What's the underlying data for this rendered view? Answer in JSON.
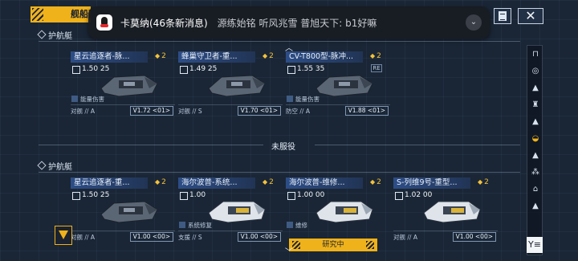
{
  "header": {
    "tab_label": "舰船蓝"
  },
  "notification": {
    "title": "卡莫纳(46条新消息)",
    "message": "源练始铭 听风兆雪  普旭天下: b1好嘛",
    "expand_icon": "chevron-down-icon"
  },
  "toolbar": {
    "doc_icon": "document-icon",
    "close_icon": "close-icon",
    "close_label": "✕"
  },
  "sections": {
    "escort_top": "护航艇",
    "unassigned": "未服役",
    "escort_bottom": "护航艇"
  },
  "active_ships": [
    {
      "name": "星云追逐者-脉...",
      "badge": "2",
      "level": "1.50",
      "level_suffix": "25",
      "tag": "能量伤害",
      "role": "对舰",
      "grade": "A",
      "version": "V1.72 <01>"
    },
    {
      "name": "蜂巢守卫者-重...",
      "badge": "2",
      "level": "1.49",
      "level_suffix": "25",
      "tag": "",
      "role": "对舰",
      "grade": "S",
      "version": "V1.70 <01>"
    },
    {
      "name": "CV-T800型-脉冲...",
      "badge": "2",
      "level": "1.55",
      "level_suffix": "35",
      "extra": "RE",
      "tag": "能量伤害",
      "role": "防空",
      "grade": "A",
      "version": "V1.88 <01>"
    }
  ],
  "reserve_ships": [
    {
      "name": "星云追逐者-重...",
      "badge": "2",
      "level": "1.50",
      "level_suffix": "25",
      "tag": "",
      "role": "对舰",
      "grade": "A",
      "version": "V1.00 <00>"
    },
    {
      "name": "海尔波普-系统...",
      "badge": "2",
      "level": "1.00",
      "level_suffix": "",
      "tag": "系统修复",
      "role": "支援",
      "grade": "S",
      "version": "V1.00 <00>"
    },
    {
      "name": "海尔波普-维修...",
      "badge": "2",
      "level": "1.00",
      "level_suffix": "00",
      "tag": "维修",
      "role": "",
      "grade": "",
      "version": ""
    },
    {
      "name": "S-列维9号-重型...",
      "badge": "2",
      "level": "1.02",
      "level_suffix": "00",
      "tag": "",
      "role": "对舰",
      "grade": "A",
      "version": "V1.00 <00>"
    }
  ],
  "research_label": "研究中",
  "rail_icons": [
    "carrier-icon",
    "frigate-icon",
    "destroyer-icon",
    "cruiser-icon",
    "battlecruiser-icon",
    "corvette-icon",
    "escort-icon",
    "cluster-icon",
    "base-icon",
    "aux-icon"
  ],
  "filter_label": "Y≡",
  "colors": {
    "accent": "#f0b21a",
    "name_bar": "#2d4d86",
    "background": "#1a2636"
  }
}
